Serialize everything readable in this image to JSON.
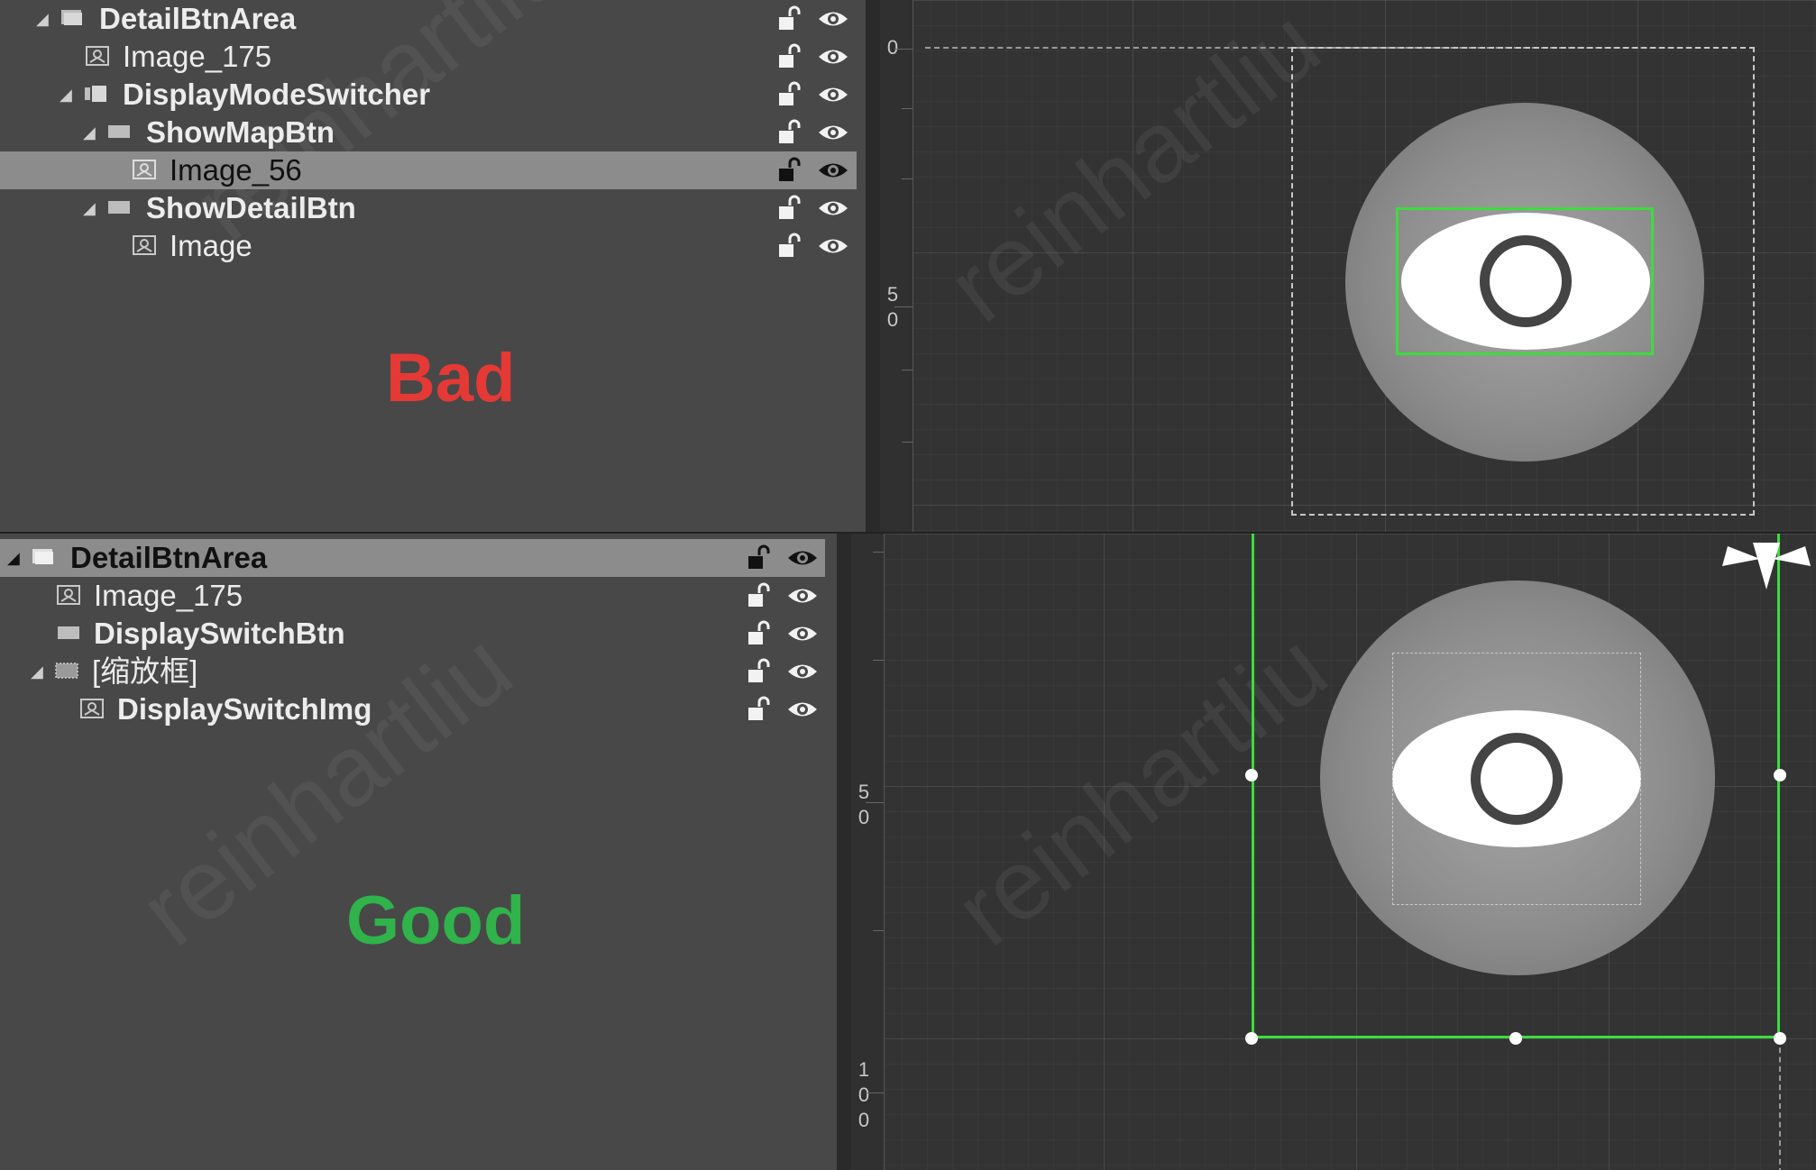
{
  "top_panel": {
    "verdict": "Bad",
    "verdict_color": "#e53935",
    "rows": [
      {
        "label": "DetailBtnArea",
        "selected": false,
        "bold": true
      },
      {
        "label": "Image_175",
        "selected": false,
        "bold": false
      },
      {
        "label": "DisplayModeSwitcher",
        "selected": false,
        "bold": true
      },
      {
        "label": "ShowMapBtn",
        "selected": false,
        "bold": true
      },
      {
        "label": "Image_56",
        "selected": true,
        "bold": false
      },
      {
        "label": "ShowDetailBtn",
        "selected": false,
        "bold": true
      },
      {
        "label": "Image",
        "selected": false,
        "bold": false
      }
    ],
    "ruler": [
      "0",
      "5",
      "0"
    ]
  },
  "bottom_panel": {
    "verdict": "Good",
    "verdict_color": "#2fb34a",
    "rows": [
      {
        "label": "DetailBtnArea",
        "selected": true,
        "bold": true
      },
      {
        "label": "Image_175",
        "selected": false,
        "bold": false
      },
      {
        "label": "DisplaySwitchBtn",
        "selected": false,
        "bold": true
      },
      {
        "label": "[缩放框]",
        "selected": false,
        "bold": false
      },
      {
        "label": "DisplaySwitchImg",
        "selected": false,
        "bold": true
      }
    ],
    "ruler": [
      "5",
      "0",
      "1",
      "0",
      "0"
    ]
  },
  "watermark": "reinhartliu",
  "colors": {
    "selection_outline": "#3ddc3d",
    "selected_row": "#8c8c8c",
    "panel_bg": "#484848",
    "viewport_bg": "#333333"
  },
  "icons": [
    "expand-arrow-icon",
    "widget-icon",
    "image-icon",
    "lock-icon",
    "eye-icon"
  ]
}
